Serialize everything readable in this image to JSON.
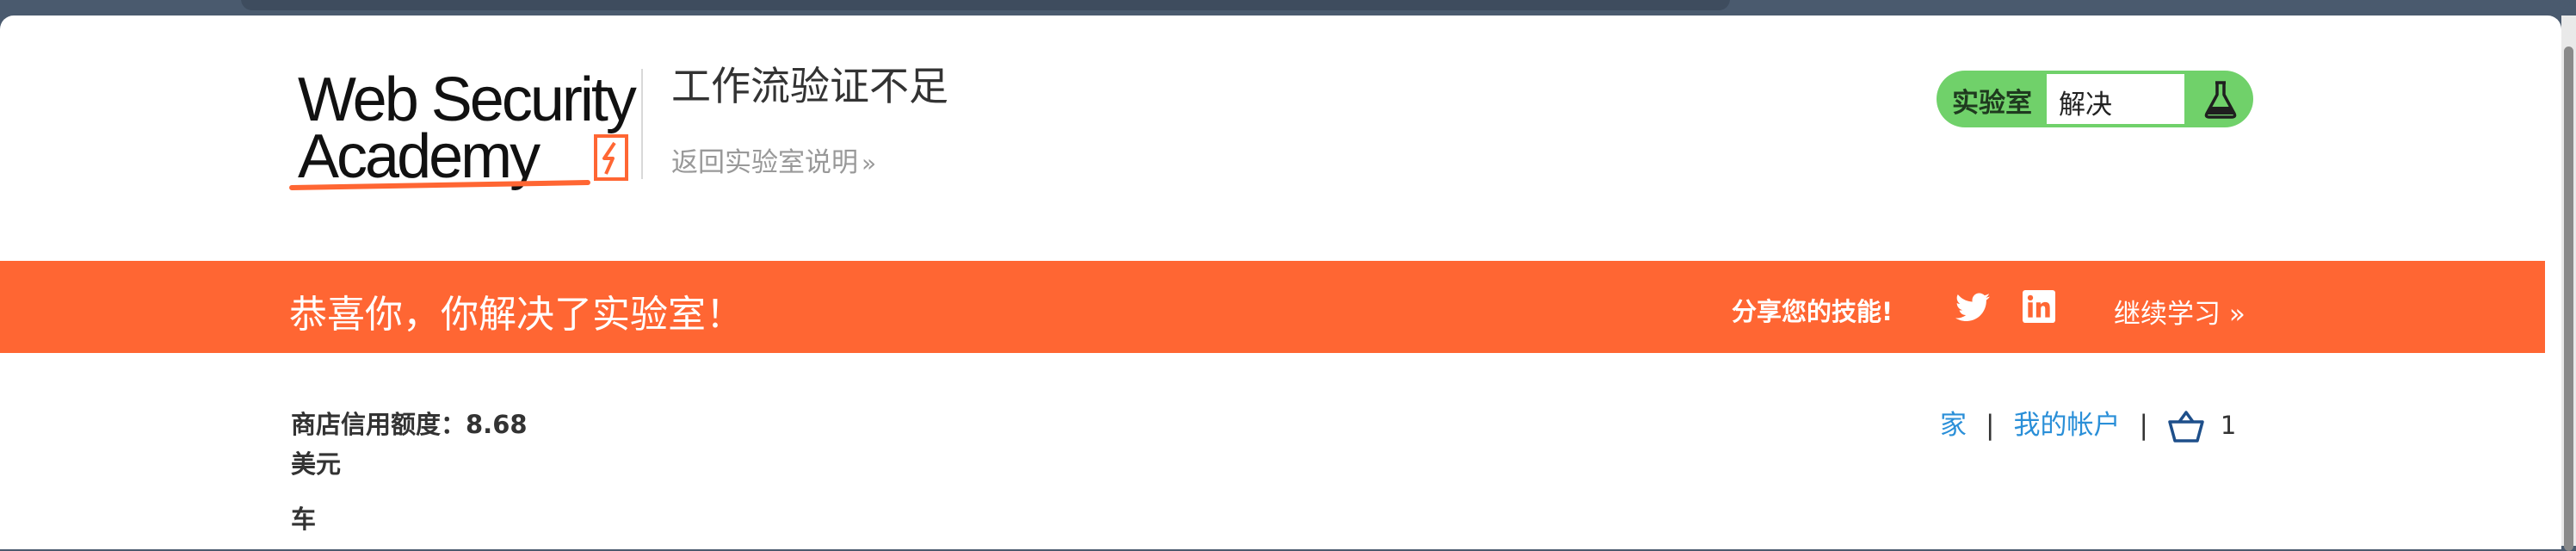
{
  "header": {
    "logo_line1": "Web Security",
    "logo_line2": "Academy",
    "lab_title": "工作流验证不足",
    "back_link": "返回实验室说明"
  },
  "lab_status": {
    "label": "实验室",
    "value": "解决"
  },
  "banner": {
    "message": "恭喜你，你解决了实验室！",
    "share_label": "分享您的技能!",
    "continue_link": "继续学习"
  },
  "content": {
    "credit_line1": "商店信用额度：8.68",
    "credit_line2": "美元",
    "cart_heading": "车"
  },
  "nav": {
    "home": "家",
    "separator": "|",
    "my_account": "我的帐户",
    "cart_count": "1"
  },
  "colors": {
    "accent": "#ff6633",
    "lab_green": "#70d16a",
    "link_blue": "#2a8fd8"
  }
}
